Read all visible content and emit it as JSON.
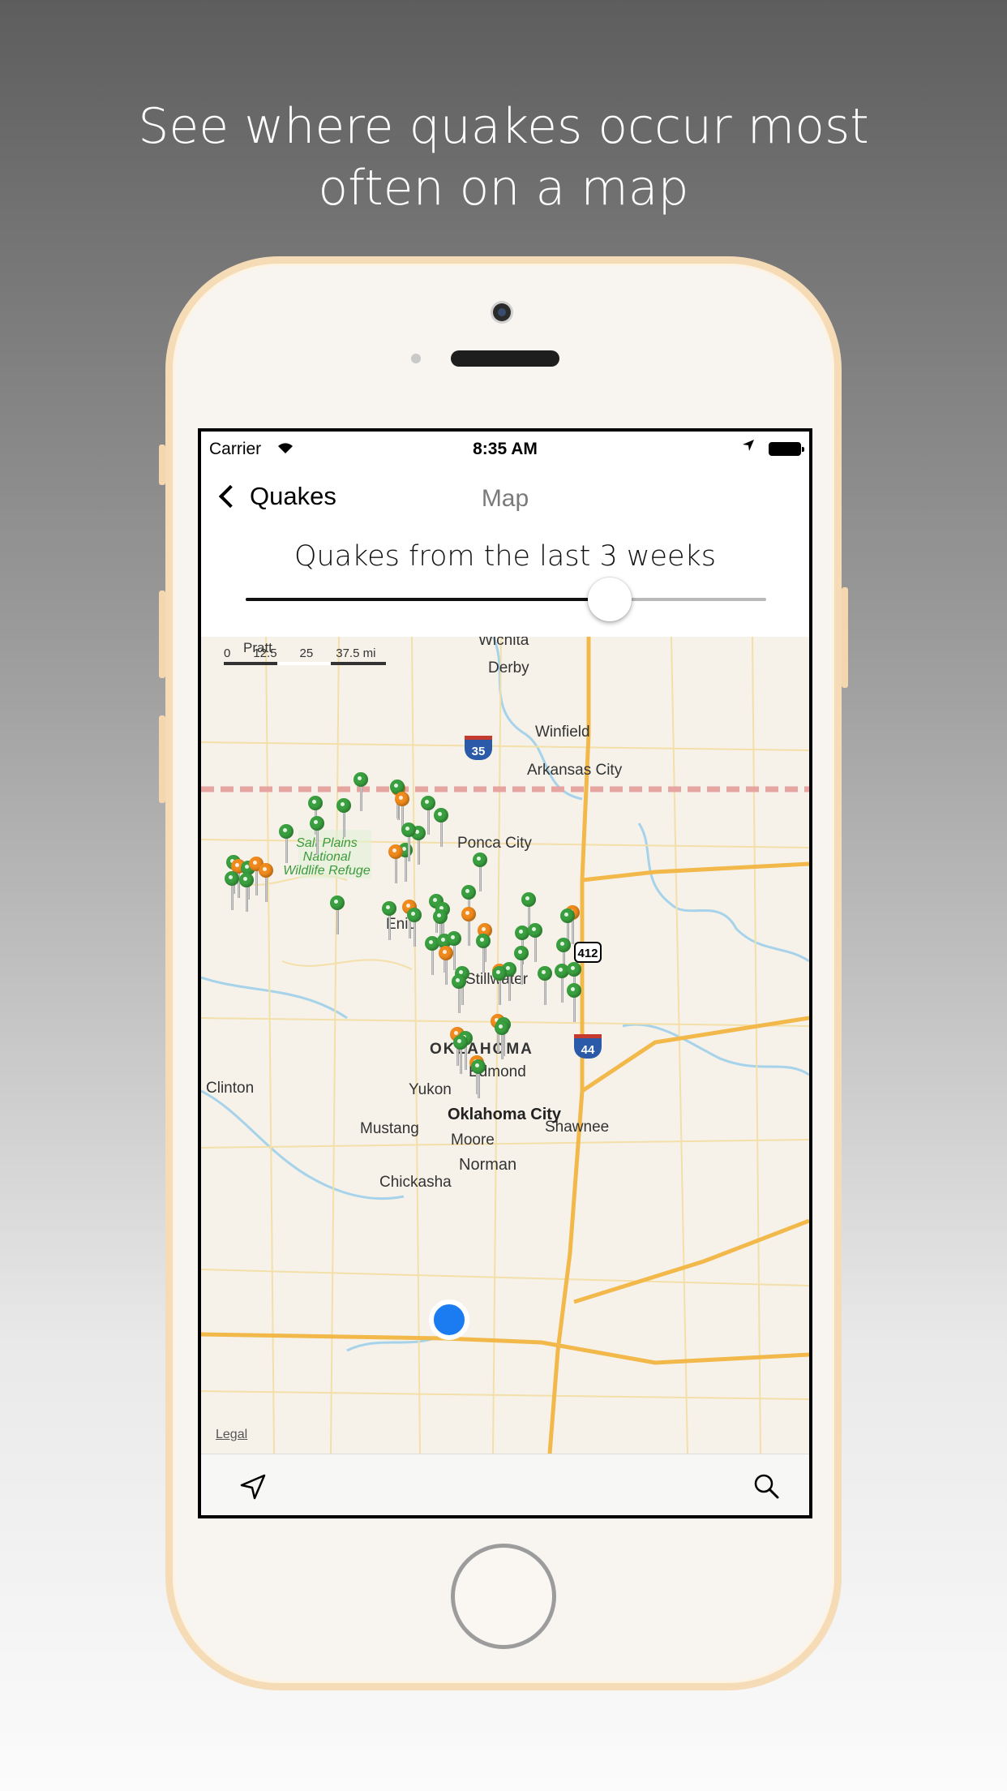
{
  "headline": {
    "line1": "See where quakes occur most",
    "line2": "often on a map"
  },
  "status_bar": {
    "carrier": "Carrier",
    "time": "8:35 AM"
  },
  "nav_bar": {
    "back_label": "Quakes",
    "title": "Map"
  },
  "filter": {
    "label": "Quakes from the last 3 weeks",
    "slider_value_fraction": 0.7
  },
  "map": {
    "scale_labels": [
      "0",
      "12.5",
      "25",
      "37.5 mi"
    ],
    "cities": [
      "Wichita",
      "Derby",
      "Winfield",
      "Arkansas City",
      "Pratt",
      "Ponca City",
      "Enid",
      "Stillwater",
      "Clinton",
      "Yukon",
      "Oklahoma City",
      "Mustang",
      "Moore",
      "Norman",
      "Shawnee",
      "Chickasha",
      "Edmond",
      "OKLAHOMA"
    ],
    "refuge_label": [
      "Salt Plains",
      "National",
      "Wildlife Refuge"
    ],
    "highway_shields": [
      "35",
      "412",
      "44"
    ],
    "legal": "Legal",
    "pin_colors": {
      "recent": "#3aa03f",
      "older": "#f08a1c"
    },
    "user_location_color": "#1b7cf2"
  },
  "toolbar": {
    "left_icon": "location-arrow-icon",
    "right_icon": "search-icon"
  }
}
